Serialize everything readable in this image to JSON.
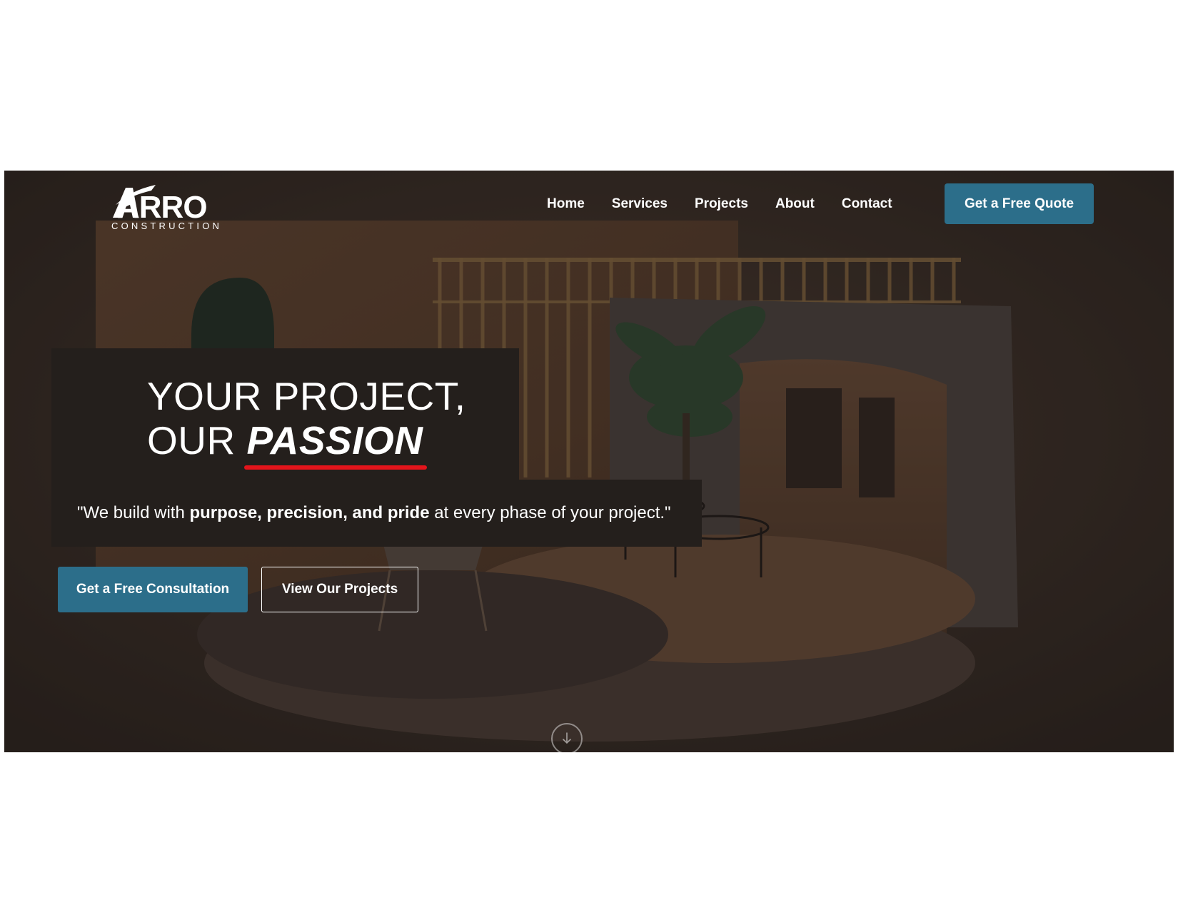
{
  "brand": {
    "logo_mark": "ARRO",
    "logo_subtitle": "CONSTRUCTION"
  },
  "nav": {
    "items": [
      {
        "label": "Home"
      },
      {
        "label": "Services"
      },
      {
        "label": "Projects"
      },
      {
        "label": "About"
      },
      {
        "label": "Contact"
      }
    ],
    "cta_label": "Get a Free Quote"
  },
  "hero": {
    "headline_line1": "YOUR PROJECT,",
    "headline_line2_prefix": "OUR ",
    "headline_accent": "PASSION",
    "tagline_open": "\"We build with ",
    "tagline_bold": "purpose, precision, and pride",
    "tagline_close": " at every phase of your project.\"",
    "primary_cta": "Get a Free Consultation",
    "secondary_cta": "View Our Projects"
  },
  "icons": {
    "scroll": "arrow-down-icon",
    "logo": "arrow-a-logo-icon"
  },
  "colors": {
    "accent": "#2c6e8a",
    "underline": "#e3141b",
    "panel": "#241f1c"
  }
}
